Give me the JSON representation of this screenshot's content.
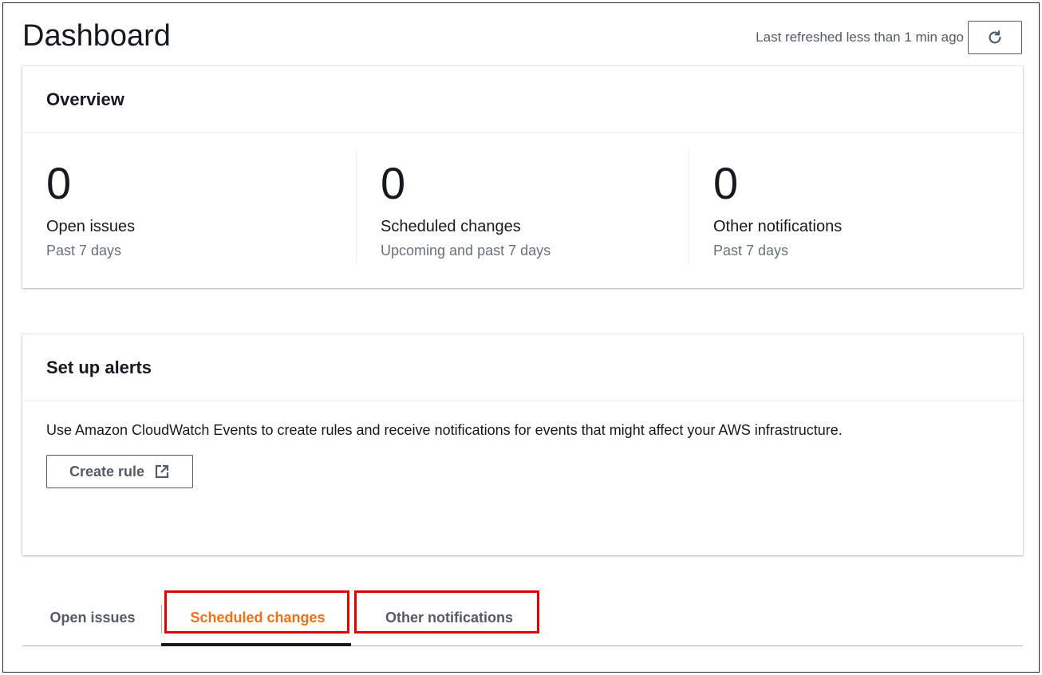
{
  "header": {
    "title": "Dashboard",
    "refresh_text": "Last refreshed less than 1 min ago",
    "refresh_icon": "refresh-icon"
  },
  "overview": {
    "title": "Overview",
    "stats": [
      {
        "value": "0",
        "label": "Open issues",
        "sub": "Past 7 days"
      },
      {
        "value": "0",
        "label": "Scheduled changes",
        "sub": "Upcoming and past 7 days"
      },
      {
        "value": "0",
        "label": "Other notifications",
        "sub": "Past 7 days"
      }
    ]
  },
  "alerts": {
    "title": "Set up alerts",
    "description": "Use Amazon CloudWatch Events to create rules and receive notifications for events that might affect your AWS infrastructure.",
    "create_rule_label": "Create rule",
    "external_icon": "external-link-icon"
  },
  "tabs": {
    "items": [
      {
        "label": "Open issues",
        "active": false
      },
      {
        "label": "Scheduled changes",
        "active": true
      },
      {
        "label": "Other notifications",
        "active": false
      }
    ]
  },
  "colors": {
    "active_tab": "#ec7211",
    "highlight": "#e00000",
    "text": "#16191f",
    "secondary_text": "#687078"
  }
}
